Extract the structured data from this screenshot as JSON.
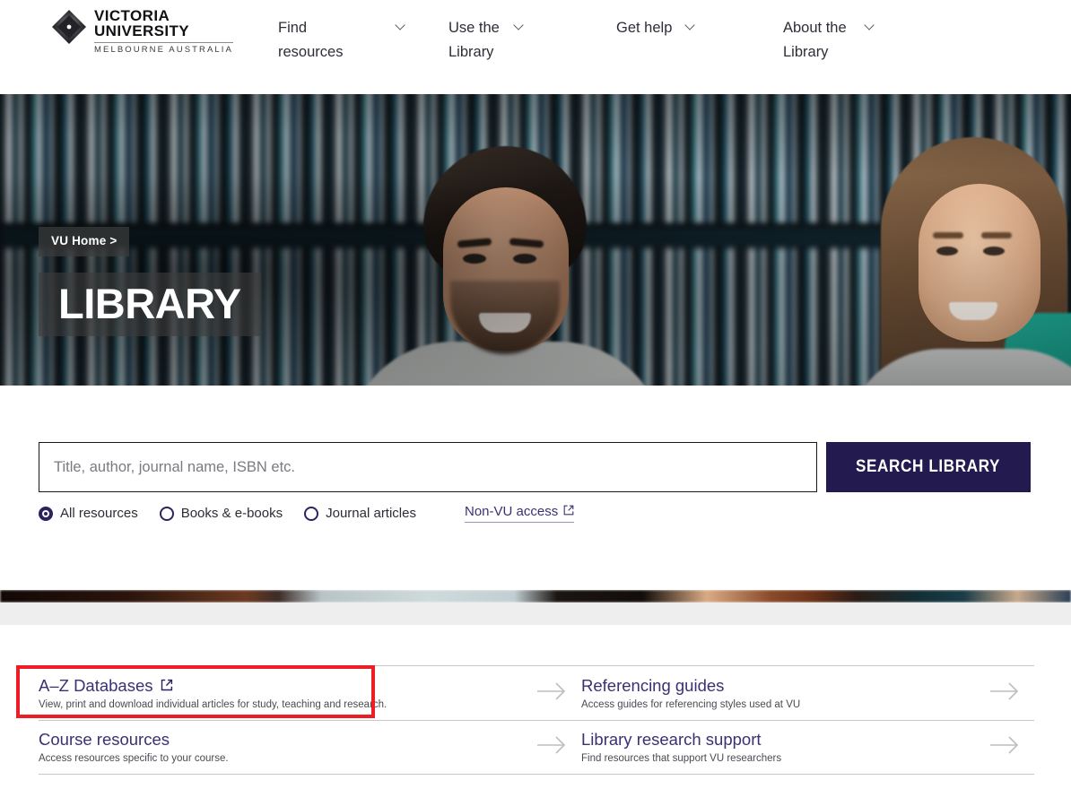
{
  "header": {
    "logo": {
      "line1": "VICTORIA",
      "line2": "UNIVERSITY",
      "line3": "MELBOURNE AUSTRALIA",
      "icon": "diamond-logo-icon"
    },
    "nav": [
      {
        "label": "Find resources",
        "caret": "chevron-down-icon"
      },
      {
        "label": "Use the Library",
        "caret": "chevron-down-icon"
      },
      {
        "label": "Get help",
        "caret": "chevron-down-icon"
      },
      {
        "label": "About the Library",
        "caret": "chevron-down-icon"
      }
    ]
  },
  "hero": {
    "breadcrumb": "VU Home  >",
    "title": "LIBRARY"
  },
  "search": {
    "placeholder": "Title, author, journal name, ISBN etc.",
    "value": "",
    "button_label": "SEARCH LIBRARY",
    "options": [
      {
        "label": "All resources",
        "selected": true
      },
      {
        "label": "Books & e-books",
        "selected": false
      },
      {
        "label": "Journal articles",
        "selected": false
      }
    ],
    "nonvu": {
      "label": "Non-VU access",
      "icon": "external-link-icon"
    }
  },
  "quicklinks": {
    "left": [
      {
        "title": "A–Z Databases",
        "external": true,
        "desc": "View, print and download individual articles for study, teaching and research.",
        "arrow": "arrow-right-icon"
      },
      {
        "title": "Course resources",
        "external": false,
        "desc": "Access resources specific to your course.",
        "arrow": "arrow-right-icon"
      }
    ],
    "right": [
      {
        "title": "Referencing guides",
        "external": false,
        "desc": "Access guides for referencing styles used at VU",
        "arrow": "arrow-right-icon"
      },
      {
        "title": "Library research support",
        "external": false,
        "desc": "Find resources that support VU researchers",
        "arrow": "arrow-right-icon"
      }
    ]
  },
  "annotation": {
    "highlight_color": "#ee1c25",
    "target": "A–Z Databases"
  },
  "colors": {
    "brand_navy": "#231a4f",
    "link_purple": "#3b3073",
    "grey_band": "#eeeeee",
    "divider": "#c8c8cc"
  }
}
